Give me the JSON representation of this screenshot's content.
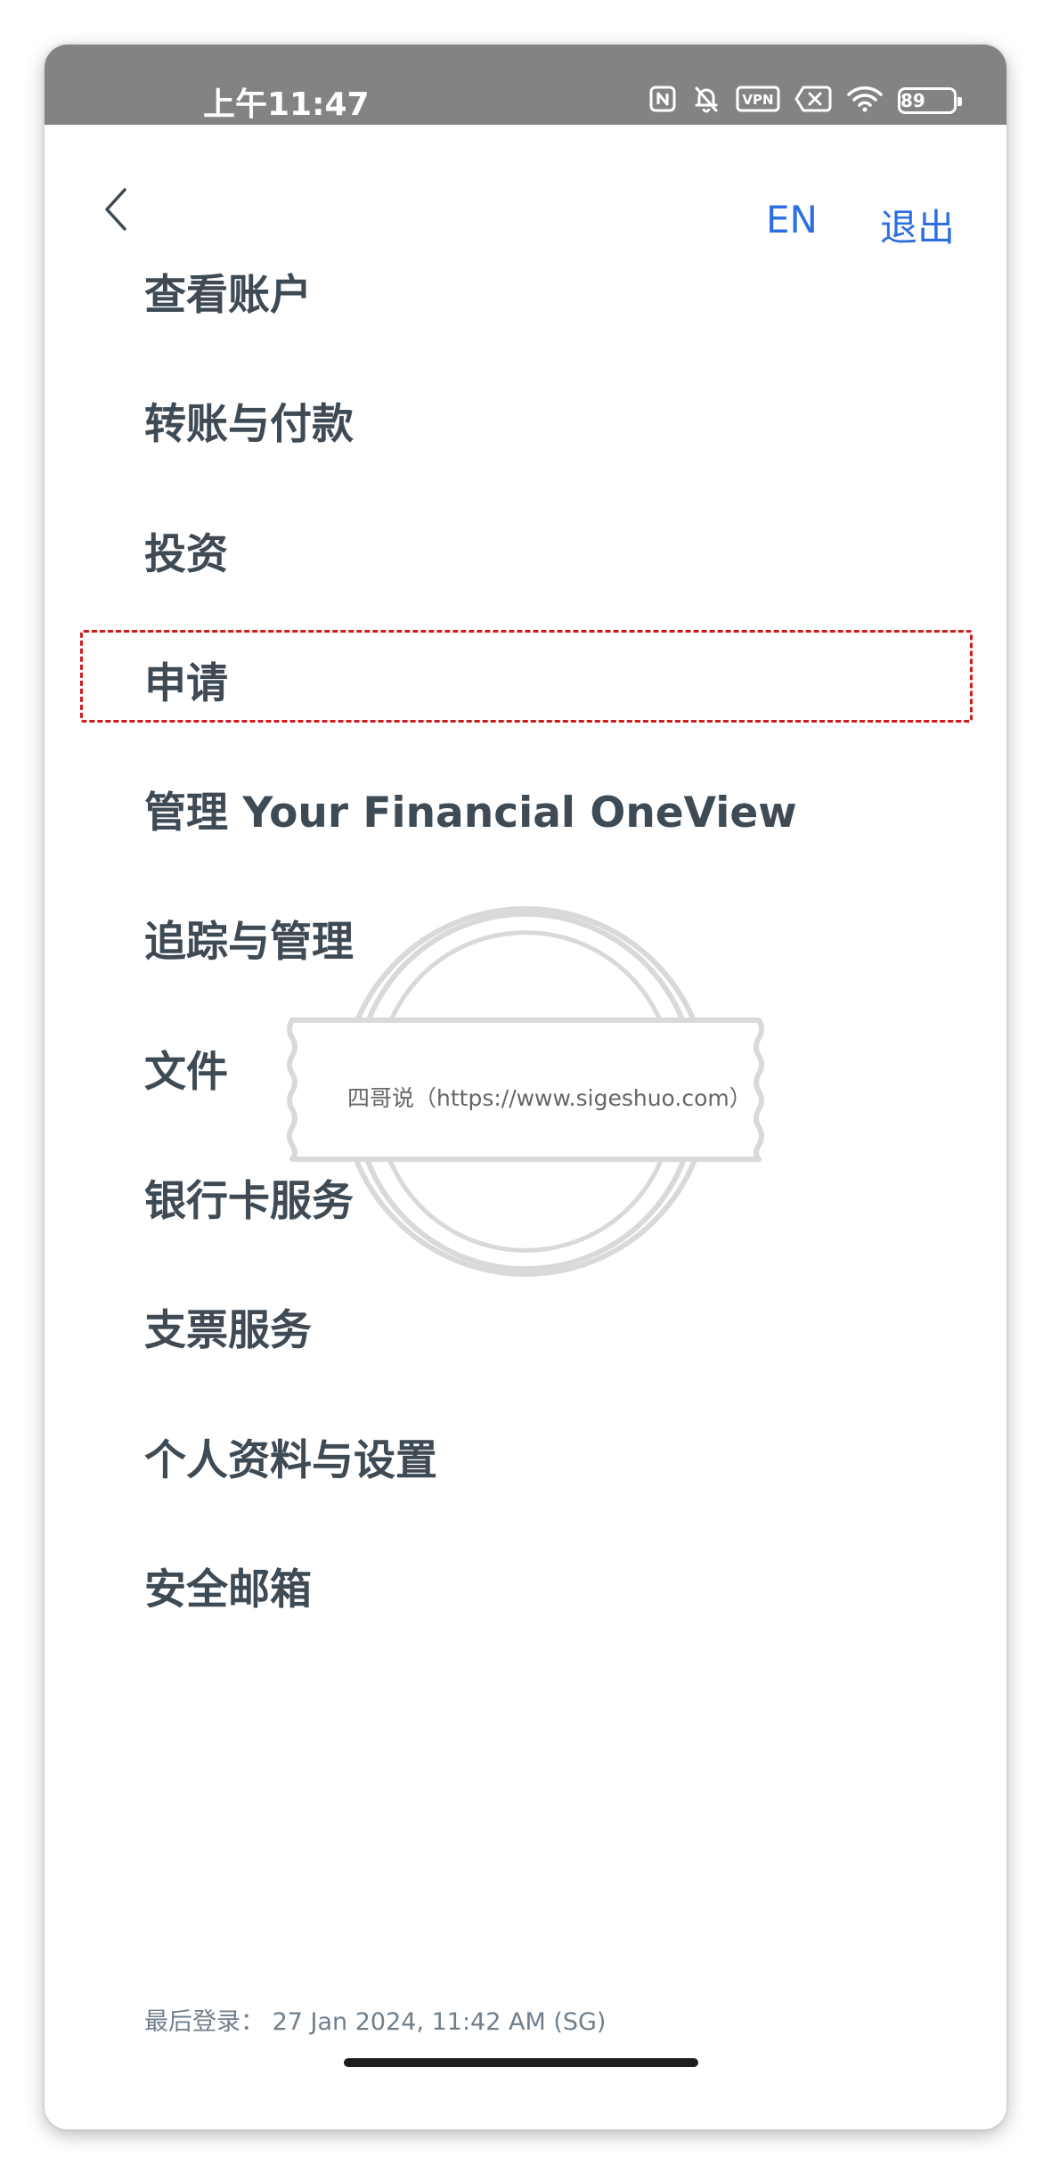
{
  "status_bar": {
    "time": "上午11:47",
    "vpn_label": "VPN",
    "battery": "89",
    "icons": [
      "nfc-icon",
      "bell-off-icon",
      "vpn-icon",
      "sim-disabled-icon",
      "wifi-icon",
      "battery-icon"
    ]
  },
  "header": {
    "back_icon": "chevron-left-icon",
    "language": "EN",
    "logout": "退出"
  },
  "menu": {
    "items": [
      {
        "label": "查看账户"
      },
      {
        "label": "转账与付款"
      },
      {
        "label": "投资"
      },
      {
        "label": "申请"
      },
      {
        "label": "管理 Your Financial OneView"
      },
      {
        "label": "追踪与管理"
      },
      {
        "label": "文件"
      },
      {
        "label": "银行卡服务"
      },
      {
        "label": "支票服务"
      },
      {
        "label": "个人资料与设置"
      },
      {
        "label": "安全邮箱"
      }
    ],
    "highlight_color": "#d11a1a"
  },
  "watermark": {
    "text": "四哥说（https://www.sigeshuo.com）"
  },
  "footer": {
    "last_login": "最后登录：  27 Jan 2024, 11:42 AM (SG)"
  },
  "colors": {
    "accent": "#2d6fe0",
    "menu_text": "#3e4a54",
    "status_bar": "#838383"
  }
}
